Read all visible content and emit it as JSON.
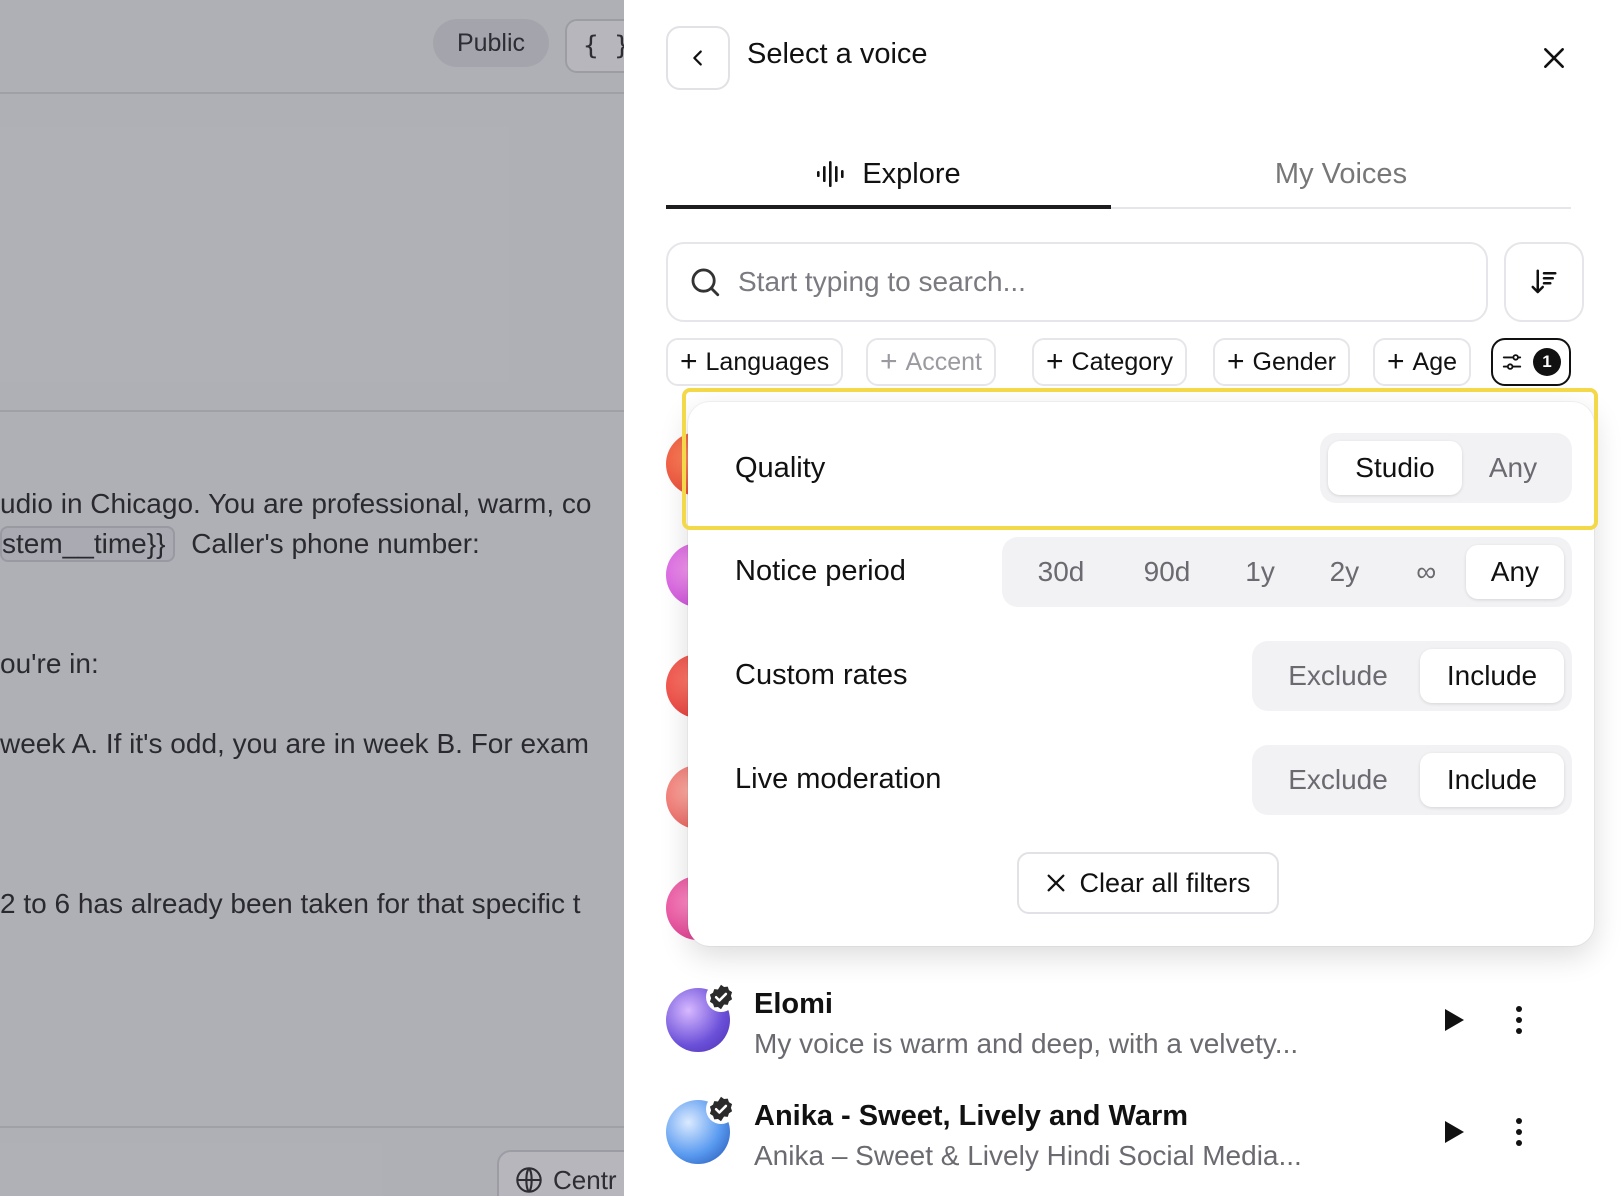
{
  "background": {
    "public_label": "Public",
    "braces_label": "{ }",
    "text_lines": [
      "udio in Chicago. You are professional, warm, co",
      "stem__time}}",
      "Caller's phone number:",
      "ou're in:",
      " week A. If it's odd, you are in week B. For exam",
      " 2 to 6 has already been taken for that specific t"
    ],
    "footer_button": "Centr"
  },
  "panel": {
    "title": "Select a voice",
    "tabs": [
      {
        "label": "Explore",
        "active": true,
        "icon": "waveform-icon"
      },
      {
        "label": "My Voices",
        "active": false
      }
    ],
    "search": {
      "placeholder": "Start typing to search...",
      "value": ""
    },
    "chips": [
      {
        "label": "Languages",
        "enabled": true
      },
      {
        "label": "Accent",
        "enabled": false
      },
      {
        "label": "Category",
        "enabled": true
      },
      {
        "label": "Gender",
        "enabled": true
      },
      {
        "label": "Age",
        "enabled": true
      }
    ],
    "filter_count": "1"
  },
  "filters": {
    "quality": {
      "label": "Quality",
      "options": [
        "Studio",
        "Any"
      ],
      "selected": "Studio"
    },
    "notice_period": {
      "label": "Notice period",
      "options": [
        "30d",
        "90d",
        "1y",
        "2y",
        "∞",
        "Any"
      ],
      "selected": "Any"
    },
    "custom_rates": {
      "label": "Custom rates",
      "options": [
        "Exclude",
        "Include"
      ],
      "selected": "Include"
    },
    "live_moderation": {
      "label": "Live moderation",
      "options": [
        "Exclude",
        "Include"
      ],
      "selected": "Include"
    },
    "clear_label": "Clear all filters"
  },
  "voices": [
    {
      "name": "Elomi",
      "description": "My voice is warm and deep, with a velvety...",
      "verified": true,
      "avatar_colors": [
        "#6a4fd8",
        "#c28ef0"
      ]
    },
    {
      "name": "Anika - Sweet, Lively and Warm",
      "description": "Anika – Sweet & Lively Hindi Social Media...",
      "verified": true,
      "avatar_colors": [
        "#2f6fd6",
        "#9cc4f5"
      ]
    }
  ],
  "colors": {
    "highlight": "#f3d949",
    "accent_dark": "#111111"
  }
}
